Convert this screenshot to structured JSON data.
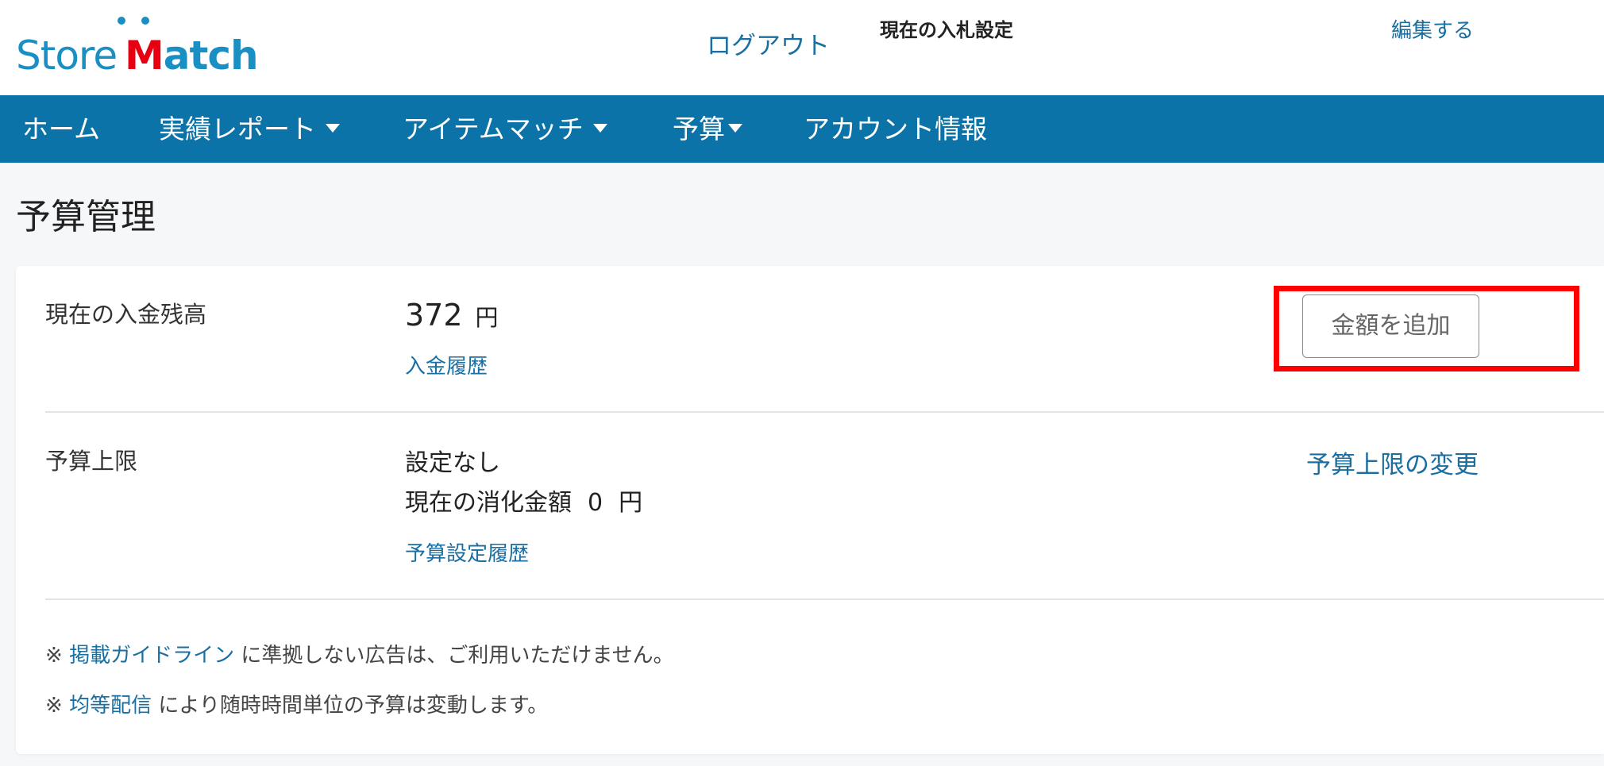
{
  "header": {
    "logo_store": "Store",
    "logo_match_m": "M",
    "logo_match_rest": "atch",
    "logout": "ログアウト",
    "bid_settings": "現在の入札設定",
    "edit": "編集する"
  },
  "nav": {
    "items": [
      {
        "label": "ホーム",
        "dropdown": false
      },
      {
        "label": "実績レポート",
        "dropdown": true
      },
      {
        "label": "アイテムマッチ",
        "dropdown": true
      },
      {
        "label": "予算",
        "dropdown": true
      },
      {
        "label": "アカウント情報",
        "dropdown": false
      }
    ]
  },
  "page": {
    "title": "予算管理"
  },
  "balance": {
    "label": "現在の入金残高",
    "amount": "372",
    "unit": "円",
    "history_link": "入金履歴",
    "add_button": "金額を追加"
  },
  "budget": {
    "label": "予算上限",
    "setting": "設定なし",
    "consumed_label": "現在の消化金額",
    "consumed_amount": "0",
    "consumed_unit": "円",
    "history_link": "予算設定履歴",
    "change_link": "予算上限の変更"
  },
  "notes": [
    {
      "mark": "※",
      "link": "掲載ガイドライン",
      "text": " に準拠しない広告は、ご利用いただけません。"
    },
    {
      "mark": "※",
      "link": "均等配信",
      "text": " により随時時間単位の予算は変動します。"
    }
  ],
  "colors": {
    "brand_blue": "#1a8fc4",
    "nav_bg": "#0c73a8",
    "link": "#1a6fa0",
    "highlight": "#ff0000",
    "logo_red": "#e60012"
  }
}
